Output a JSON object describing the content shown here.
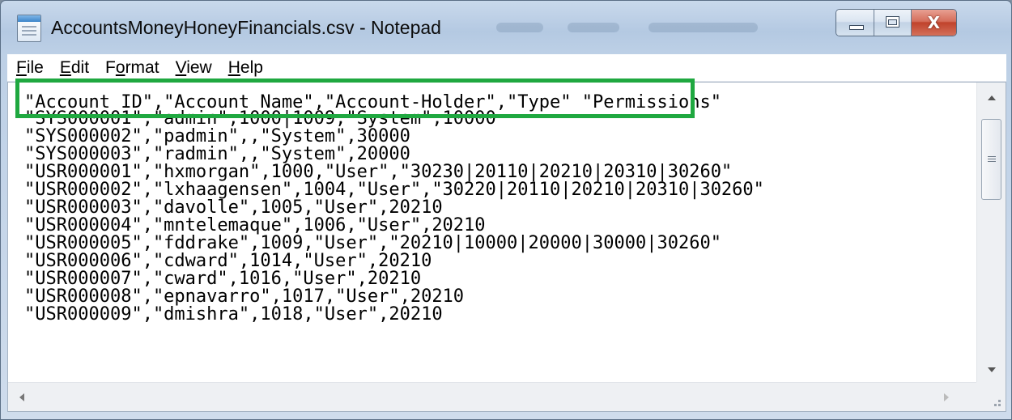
{
  "window": {
    "title": "AccountsMoneyHoneyFinancials.csv - Notepad",
    "app_icon": "notepad-icon"
  },
  "controls": {
    "minimize_icon": "minimize-icon",
    "maximize_icon": "maximize-icon",
    "close_icon": "close-icon",
    "close_glyph": "X"
  },
  "menu": [
    {
      "accel": "F",
      "rest": "ile"
    },
    {
      "accel": "E",
      "rest": "dit"
    },
    {
      "pre": "F",
      "accel": "o",
      "rest": "rmat"
    },
    {
      "accel": "V",
      "rest": "iew"
    },
    {
      "accel": "H",
      "rest": "elp"
    }
  ],
  "editor": {
    "lines": [
      "\"Account ID\",\"Account Name\",\"Account-Holder\",\"Type\" \"Permissions\"",
      "\"SYS000001\",\"admin\",1000|1009,\"System\",10000",
      "\"SYS000002\",\"padmin\",,\"System\",30000",
      "\"SYS000003\",\"radmin\",,\"System\",20000",
      "\"USR000001\",\"hxmorgan\",1000,\"User\",\"30230|20110|20210|20310|30260\"",
      "\"USR000002\",\"lxhaagensen\",1004,\"User\",\"30220|20110|20210|20310|30260\"",
      "\"USR000003\",\"davolle\",1005,\"User\",20210",
      "\"USR000004\",\"mntelemaque\",1006,\"User\",20210",
      "\"USR000005\",\"fddrake\",1009,\"User\",\"20210|10000|20000|30000|30260\"",
      "\"USR000006\",\"cdward\",1014,\"User\",20210",
      "\"USR000007\",\"cward\",1016,\"User\",20210",
      "\"USR000008\",\"epnavarro\",1017,\"User\",20210",
      "\"USR000009\",\"dmishra\",1018,\"User\",20210"
    ],
    "highlight_color": "#1fa840"
  }
}
